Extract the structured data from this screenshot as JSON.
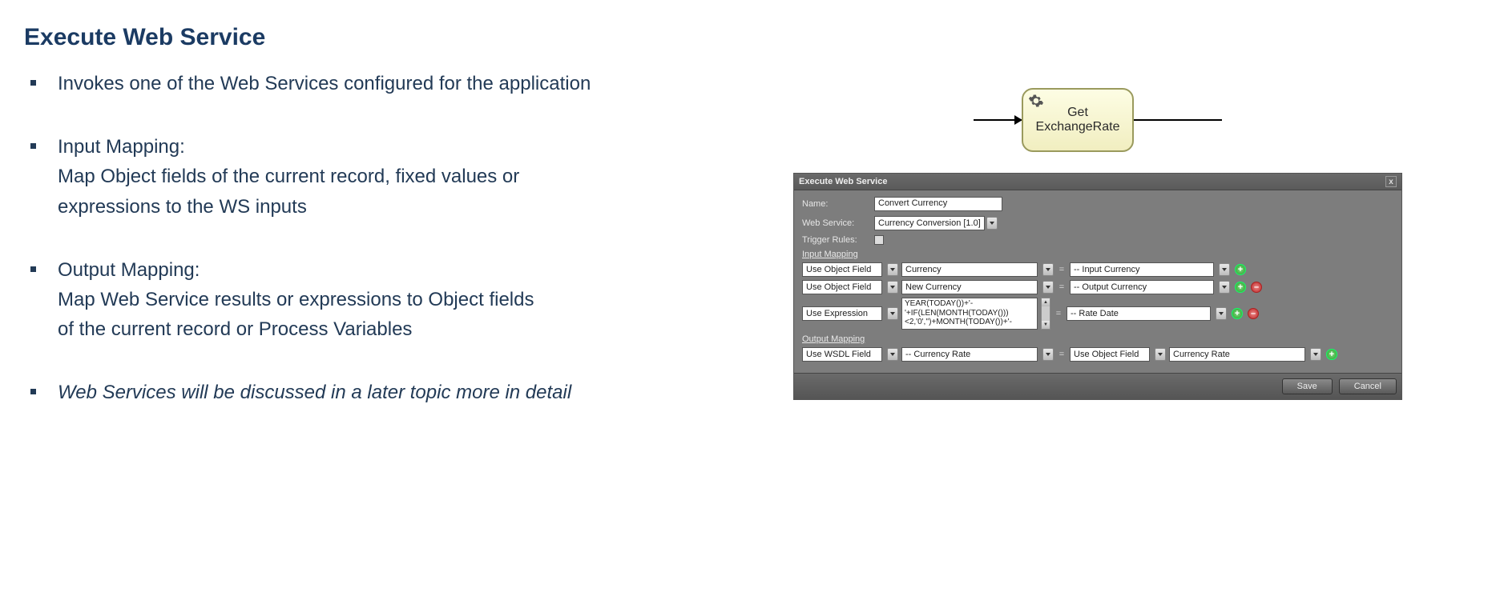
{
  "title": "Execute Web Service",
  "bullets": {
    "b1": "Invokes one of the Web Services configured for the application",
    "b2_head": "Input Mapping:",
    "b2_body1": "Map Object fields of the current record, fixed values or",
    "b2_body2": "expressions to the WS inputs",
    "b3_head": "Output Mapping:",
    "b3_body1": "Map Web Service results or expressions to Object fields",
    "b3_body2": "of the current record or Process Variables",
    "b4": "Web Services will be discussed in a later topic more in detail"
  },
  "node": {
    "line1": "Get",
    "line2": "ExchangeRate"
  },
  "dialog": {
    "title": "Execute Web Service",
    "name_label": "Name:",
    "name_value": "Convert Currency",
    "ws_label": "Web Service:",
    "ws_value": "Currency Conversion [1.0]",
    "trigger_label": "Trigger Rules:",
    "input_section": "Input Mapping",
    "output_section": "Output Mapping",
    "rows": {
      "in1": {
        "source_type": "Use Object Field",
        "source_val": "Currency",
        "target": "-- Input Currency"
      },
      "in2": {
        "source_type": "Use Object Field",
        "source_val": "New Currency",
        "target": "-- Output Currency"
      },
      "in3": {
        "source_type": "Use Expression",
        "source_val": "YEAR(TODAY())+'-'+IF(LEN(MONTH(TODAY()))<2,'0','')+MONTH(TODAY())+'-",
        "target": "-- Rate Date"
      },
      "out1": {
        "source_type": "Use WSDL Field",
        "source_val": "-- Currency Rate",
        "target_type": "Use Object Field",
        "target_val": "Currency Rate"
      }
    },
    "save": "Save",
    "cancel": "Cancel",
    "close_x": "x"
  }
}
